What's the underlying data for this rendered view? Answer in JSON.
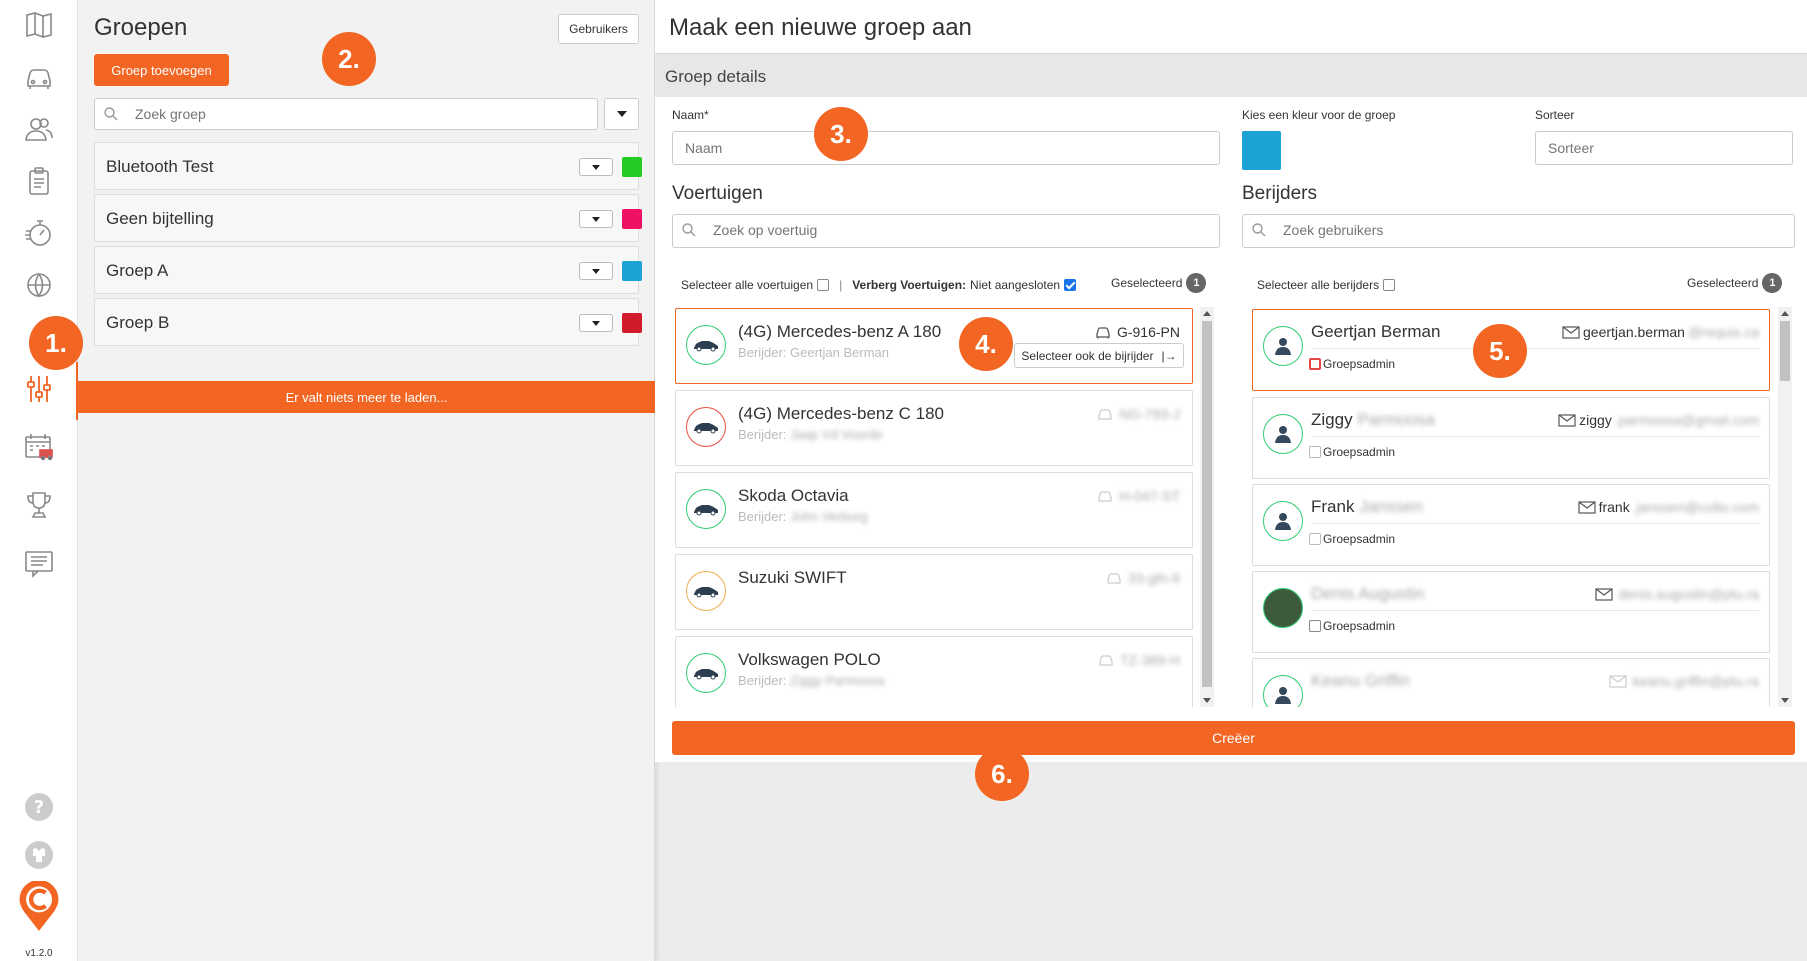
{
  "app": {
    "version": "v1.2.0",
    "accent": "#f26522",
    "nav_icons": [
      "map-icon",
      "car-icon",
      "users-icon",
      "clipboard-icon",
      "stopwatch-icon",
      "globe-icon",
      "sliders-icon",
      "calendar-truck-icon",
      "trophy-icon",
      "message-icon",
      "help-icon",
      "settings-icon",
      "logo-icon"
    ]
  },
  "groups": {
    "title": "Groepen",
    "users_button": "Gebruikers",
    "add_button": "Groep toevoegen",
    "search_placeholder": "Zoek groep",
    "items": [
      {
        "name": "Bluetooth Test",
        "color": "#22cc22"
      },
      {
        "name": "Geen bijtelling",
        "color": "#ee1166"
      },
      {
        "name": "Groep A",
        "color": "#1ba3d4"
      },
      {
        "name": "Groep B",
        "color": "#d11a2a"
      }
    ],
    "load_more": "Er valt niets meer te laden..."
  },
  "form": {
    "title": "Maak een nieuwe groep aan",
    "section": "Groep details",
    "name_label": "Naam*",
    "name_placeholder": "Naam",
    "color_label": "Kies een kleur voor de groep",
    "color_value": "#1ba3d4",
    "sort_label": "Sorteer",
    "sort_placeholder": "Sorteer",
    "create_button": "Creëer"
  },
  "vehicles": {
    "title": "Voertuigen",
    "search_placeholder": "Zoek op voertuig",
    "select_all": "Selecteer alle voertuigen",
    "divider": "|",
    "hide_label": "Verberg Voertuigen:",
    "hide_value": "Niet aangesloten",
    "selected_label": "Geselecteerd",
    "selected_count": "1",
    "select_driver_button": "Selecteer ook de bijrijder",
    "items": [
      {
        "name": "(4G) Mercedes-benz A 180",
        "driver": "Berijder: Geertjan Berman",
        "plate": "G-916-PN",
        "ring": "#2ecc71"
      },
      {
        "name": "(4G) Mercedes-benz C 180",
        "driver": "Berijder:",
        "plate": "",
        "ring": "#e74c3c"
      },
      {
        "name": "Skoda Octavia",
        "driver": "Berijder:",
        "plate": "",
        "ring": "#2ecc71"
      },
      {
        "name": "Suzuki SWIFT",
        "driver": "",
        "plate": "",
        "ring": "#f0ad4e"
      },
      {
        "name": "Volkswagen POLO",
        "driver": "Berijder:",
        "plate": "",
        "ring": "#2ecc71"
      }
    ]
  },
  "drivers": {
    "title": "Berijders",
    "search_placeholder": "Zoek gebruikers",
    "select_all": "Selecteer alle berijders",
    "selected_label": "Geselecteerd",
    "selected_count": "1",
    "admin_label": "Groepsadmin",
    "items": [
      {
        "name": "Geertjan Berman",
        "email": "geertjan.berman"
      },
      {
        "name": "Ziggy",
        "email": "ziggy"
      },
      {
        "name": "Frank",
        "email": "frank"
      },
      {
        "name": "",
        "email": ""
      },
      {
        "name": "",
        "email": ""
      }
    ]
  },
  "markers": [
    "1.",
    "2.",
    "3.",
    "4.",
    "5.",
    "6."
  ]
}
